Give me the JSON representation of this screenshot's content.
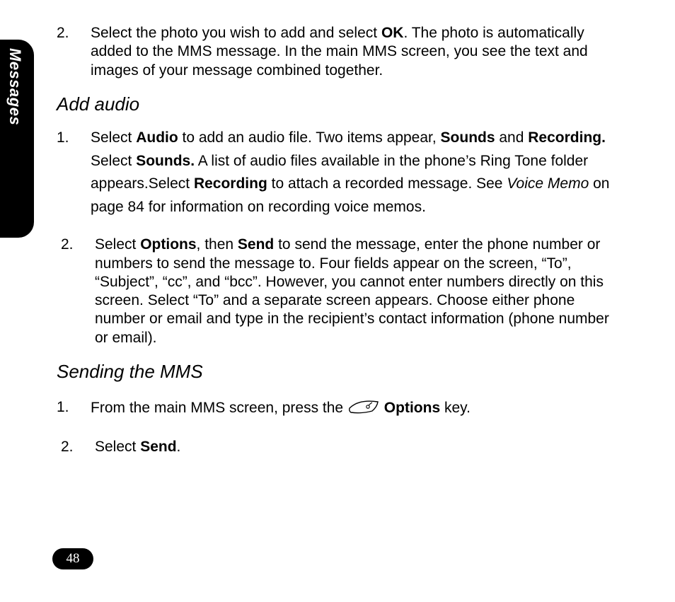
{
  "side_tab": {
    "label": "Messages"
  },
  "page_number": "48",
  "section_top": {
    "item": {
      "num": "2.",
      "parts": [
        {
          "t": "Select the photo you wish to add and select "
        },
        {
          "t": "OK",
          "b": true
        },
        {
          "t": ". The photo is automatically added to the MMS message. In the main MMS screen, you see the text and images of your message combined together."
        }
      ]
    }
  },
  "section_add_audio": {
    "heading": "Add audio",
    "item1": {
      "num": "1.",
      "parts": [
        {
          "t": "Select "
        },
        {
          "t": "Audio",
          "b": true
        },
        {
          "t": " to add an audio file. Two items appear, "
        },
        {
          "t": "Sounds",
          "b": true
        },
        {
          "t": " and "
        },
        {
          "t": "Recording.",
          "b": true
        },
        {
          "t": " Select "
        },
        {
          "t": "Sounds.",
          "b": true
        },
        {
          "t": " A list of audio files available in the phone’s Ring Tone folder appears.Select "
        },
        {
          "t": "Recording",
          "b": true
        },
        {
          "t": " to attach a recorded message. See "
        },
        {
          "t": "Voice Memo",
          "i": true
        },
        {
          "t": " on page 84 for information on recording voice memos."
        }
      ]
    },
    "item2": {
      "num": "2.",
      "parts": [
        {
          "t": "Select "
        },
        {
          "t": "Options",
          "b": true
        },
        {
          "t": ", then "
        },
        {
          "t": "Send",
          "b": true
        },
        {
          "t": " to send the message, enter the phone number or numbers to send the message to. Four fields appear on the screen, “To”, “Subject”, “cc”, and “bcc”. However, you cannot enter numbers directly on this screen. Select “To” and a separate screen appears. Choose either phone number or email and type in the recipient’s contact information (phone number or email)."
        }
      ]
    }
  },
  "section_sending": {
    "heading": "Sending the MMS",
    "item1": {
      "num": "1.",
      "parts_before": [
        {
          "t": "From the main MMS screen, press the "
        }
      ],
      "parts_after": [
        {
          "t": " "
        },
        {
          "t": "Options",
          "b": true
        },
        {
          "t": " key."
        }
      ]
    },
    "item2": {
      "num": "2.",
      "parts": [
        {
          "t": "Select "
        },
        {
          "t": "Send",
          "b": true
        },
        {
          "t": "."
        }
      ]
    }
  }
}
